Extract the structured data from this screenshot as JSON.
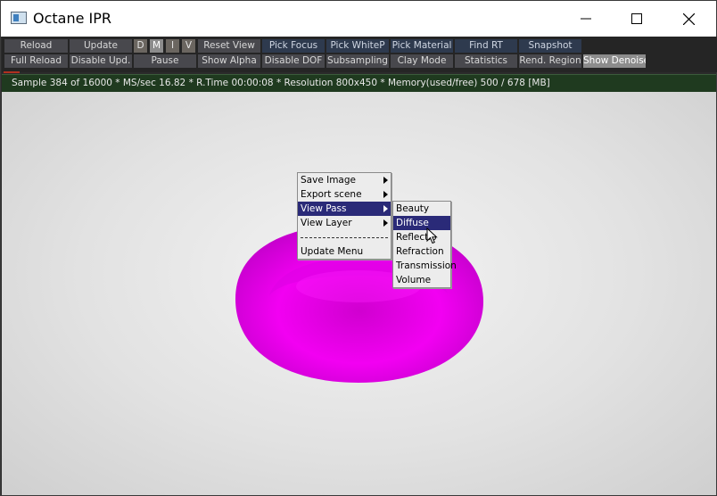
{
  "window": {
    "title": "Octane IPR"
  },
  "toolbar": {
    "row1": {
      "reload": "Reload",
      "update": "Update",
      "d": "D",
      "m": "M",
      "i": "I",
      "v": "V",
      "reset_view": "Reset View",
      "pick_focus": "Pick Focus",
      "pick_whitep": "Pick WhiteP",
      "pick_material": "Pick Material",
      "find_rt": "Find RT",
      "snapshot": "Snapshot"
    },
    "row2": {
      "full_reload": "Full Reload",
      "disable_upd": "Disable Upd.",
      "pause": "Pause",
      "show_alpha": "Show Alpha",
      "disable_dof": "Disable DOF",
      "subsampling": "Subsampling",
      "clay_mode": "Clay Mode",
      "statistics": "Statistics",
      "rend_region": "Rend. Region",
      "show_denoise": "Show Denoise"
    }
  },
  "status": {
    "text": "Sample 384 of 16000 * MS/sec 16.82 * R.Time 00:00:08 * Resolution 800x450 * Memory(used/free) 500 / 678 [MB]"
  },
  "context_menu": {
    "items": [
      {
        "label": "Save Image"
      },
      {
        "label": "Export scene"
      },
      {
        "label": "View Pass"
      },
      {
        "label": "View Layer"
      },
      {
        "label": "Update Menu"
      }
    ]
  },
  "submenu": {
    "items": [
      {
        "label": "Beauty"
      },
      {
        "label": "Diffuse"
      },
      {
        "label": "Reflectio"
      },
      {
        "label": "Refraction"
      },
      {
        "label": "Transmission"
      },
      {
        "label": "Volume"
      }
    ]
  },
  "colors": {
    "torus": "#ff00ff",
    "menu_highlight": "#2a2a78",
    "status_bg": "#1f3a1f"
  }
}
